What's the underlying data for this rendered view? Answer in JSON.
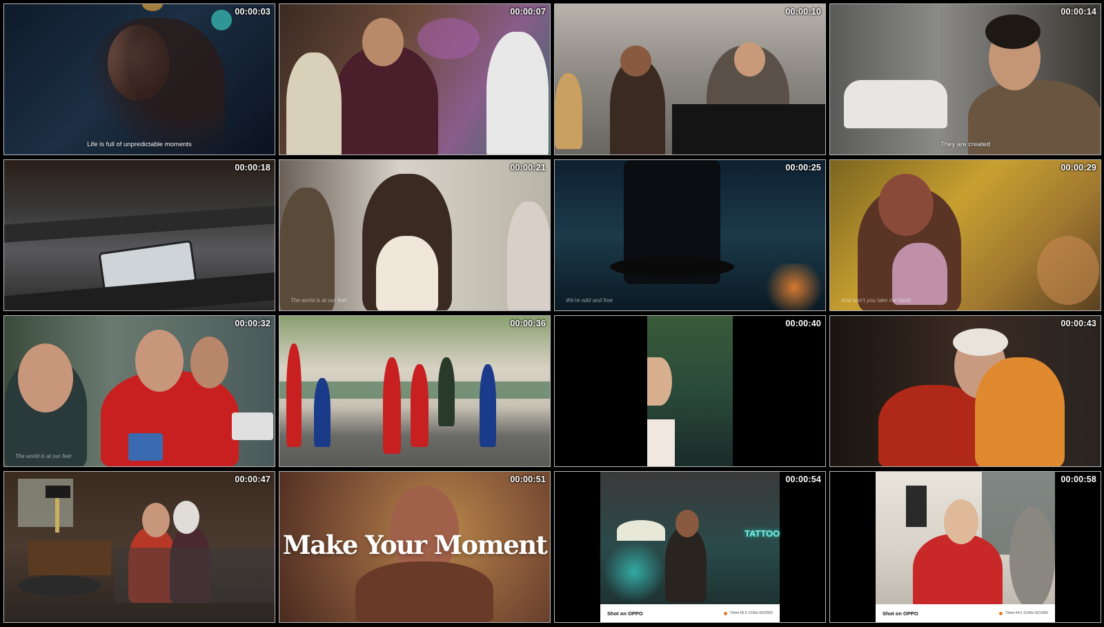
{
  "frames": [
    {
      "timestamp": "00:00:03",
      "caption": "Life is full of unpredictable moments"
    },
    {
      "timestamp": "00:00:07",
      "caption": ""
    },
    {
      "timestamp": "00:00:10",
      "caption": ""
    },
    {
      "timestamp": "00:00:14",
      "caption": "They are created"
    },
    {
      "timestamp": "00:00:18",
      "caption": ""
    },
    {
      "timestamp": "00:00:21",
      "caption": "The world is at our feet"
    },
    {
      "timestamp": "00:00:25",
      "caption": "We're wild and free"
    },
    {
      "timestamp": "00:00:29",
      "caption": "And won't you take me hand"
    },
    {
      "timestamp": "00:00:32",
      "caption": "The world is at our feet"
    },
    {
      "timestamp": "00:00:36",
      "caption": ""
    },
    {
      "timestamp": "00:00:40",
      "caption": ""
    },
    {
      "timestamp": "00:00:43",
      "caption": ""
    },
    {
      "timestamp": "00:00:47",
      "caption": ""
    },
    {
      "timestamp": "00:00:51",
      "caption": "",
      "overlay": "Make Your Moment"
    },
    {
      "timestamp": "00:00:54",
      "caption": "",
      "shot_label": "Shot on OPPO",
      "shot_meta": "73mm f/5.6 1/160s ISO2500",
      "sign": "TATTOO"
    },
    {
      "timestamp": "00:00:58",
      "caption": "",
      "shot_label": "Shot on OPPO",
      "shot_meta": "73mm f/4.0 1/140s ISO1500"
    }
  ]
}
